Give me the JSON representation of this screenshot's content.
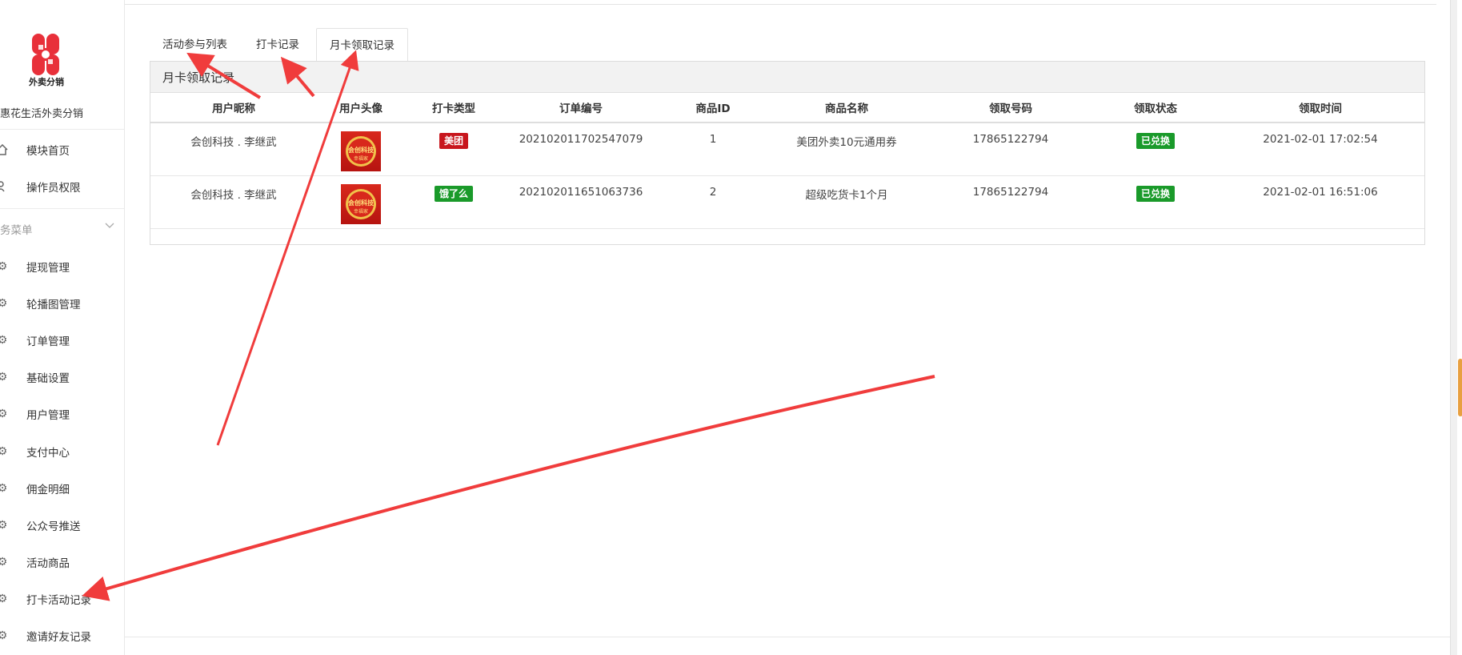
{
  "sidebar": {
    "logo_text": "外卖分销",
    "app_name": "惠花生活外卖分销",
    "top_items": [
      {
        "label": "模块首页",
        "icon": "home-icon"
      },
      {
        "label": "操作员权限",
        "icon": "user-key-icon"
      }
    ],
    "section_label": "务菜单",
    "items": [
      {
        "label": "提现管理",
        "icon": "gear-icon"
      },
      {
        "label": "轮播图管理",
        "icon": "gear-icon"
      },
      {
        "label": "订单管理",
        "icon": "gear-icon"
      },
      {
        "label": "基础设置",
        "icon": "gear-icon"
      },
      {
        "label": "用户管理",
        "icon": "gear-icon"
      },
      {
        "label": "支付中心",
        "icon": "gear-icon"
      },
      {
        "label": "佣金明细",
        "icon": "gear-icon"
      },
      {
        "label": "公众号推送",
        "icon": "gear-icon"
      },
      {
        "label": "活动商品",
        "icon": "gear-icon"
      },
      {
        "label": "打卡活动记录",
        "icon": "gear-icon"
      },
      {
        "label": "邀请好友记录",
        "icon": "gear-icon"
      }
    ]
  },
  "tabs": [
    {
      "label": "活动参与列表",
      "active": false
    },
    {
      "label": "打卡记录",
      "active": false
    },
    {
      "label": "月卡领取记录",
      "active": true
    }
  ],
  "panel": {
    "title": "月卡领取记录",
    "columns": [
      "用户昵称",
      "用户头像",
      "打卡类型",
      "订单编号",
      "商品ID",
      "商品名称",
      "领取号码",
      "领取状态",
      "领取时间"
    ],
    "rows": [
      {
        "nickname": "会创科技 . 李继武",
        "avatar_text": "会创科技",
        "avatar_sub": "幸福家",
        "type": "美团",
        "type_color": "#c8161d",
        "order_no": "202102011702547079",
        "product_id": "1",
        "product_name": "美团外卖10元通用券",
        "phone": "17865122794",
        "status": "已兑换",
        "time": "2021-02-01 17:02:54"
      },
      {
        "nickname": "会创科技 . 李继武",
        "avatar_text": "会创科技",
        "avatar_sub": "幸福家",
        "type": "饿了么",
        "type_color": "#1a9a2a",
        "order_no": "202102011651063736",
        "product_id": "2",
        "product_name": "超级吃货卡1个月",
        "phone": "17865122794",
        "status": "已兑换",
        "time": "2021-02-01 16:51:06"
      }
    ]
  },
  "colors": {
    "badge_red": "#c8161d",
    "badge_green": "#1a9a2a",
    "annotation_arrow": "#f03c3c",
    "logo_red": "#e8303a"
  }
}
